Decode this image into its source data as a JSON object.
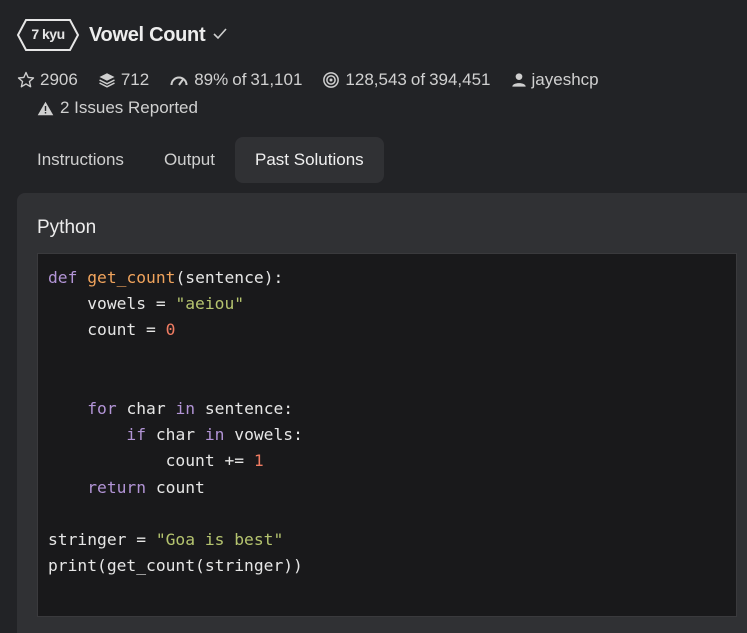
{
  "kata": {
    "rank": "7 kyu",
    "title": "Vowel Count",
    "completed": true
  },
  "stats": {
    "stars": "2906",
    "collections": "712",
    "satisfaction_pct": "89%",
    "satisfaction_of": "of",
    "satisfaction_votes": "31,101",
    "completed": "128,543",
    "completed_of": "of",
    "attempted": "394,451",
    "author": "jayeshcp"
  },
  "issues": "2 Issues Reported",
  "tabs": [
    {
      "label": "Instructions",
      "active": false
    },
    {
      "label": "Output",
      "active": false
    },
    {
      "label": "Past Solutions",
      "active": true
    }
  ],
  "solution": {
    "language": "Python",
    "code_lines": [
      [
        {
          "t": "def",
          "c": "kw"
        },
        {
          "t": " "
        },
        {
          "t": "get_count",
          "c": "fn"
        },
        {
          "t": "(sentence):"
        }
      ],
      [
        {
          "t": "    vowels = "
        },
        {
          "t": "\"aeiou\"",
          "c": "str"
        }
      ],
      [
        {
          "t": "    count = "
        },
        {
          "t": "0",
          "c": "num"
        }
      ],
      [],
      [],
      [
        {
          "t": "    "
        },
        {
          "t": "for",
          "c": "kw"
        },
        {
          "t": " char "
        },
        {
          "t": "in",
          "c": "kw"
        },
        {
          "t": " sentence:"
        }
      ],
      [
        {
          "t": "        "
        },
        {
          "t": "if",
          "c": "kw"
        },
        {
          "t": " char "
        },
        {
          "t": "in",
          "c": "kw"
        },
        {
          "t": " vowels:"
        }
      ],
      [
        {
          "t": "            count += "
        },
        {
          "t": "1",
          "c": "num"
        }
      ],
      [
        {
          "t": "    "
        },
        {
          "t": "return",
          "c": "kw"
        },
        {
          "t": " count"
        }
      ],
      [],
      [
        {
          "t": "stringer = "
        },
        {
          "t": "\"Goa is best\"",
          "c": "str"
        }
      ],
      [
        {
          "t": "print(get_count(stringer))"
        }
      ]
    ]
  },
  "colors": {
    "background": "#222326",
    "panel": "#303134",
    "code_bg": "#19191b",
    "keyword": "#b294d6",
    "function": "#f0a35c",
    "string": "#b5c46f",
    "number": "#f07c62"
  },
  "icons": {
    "completed": "check-icon",
    "stars": "star-icon",
    "collections": "layers-icon",
    "satisfaction": "gauge-icon",
    "completed_count": "target-icon",
    "author": "user-icon",
    "issues": "warning-icon"
  }
}
